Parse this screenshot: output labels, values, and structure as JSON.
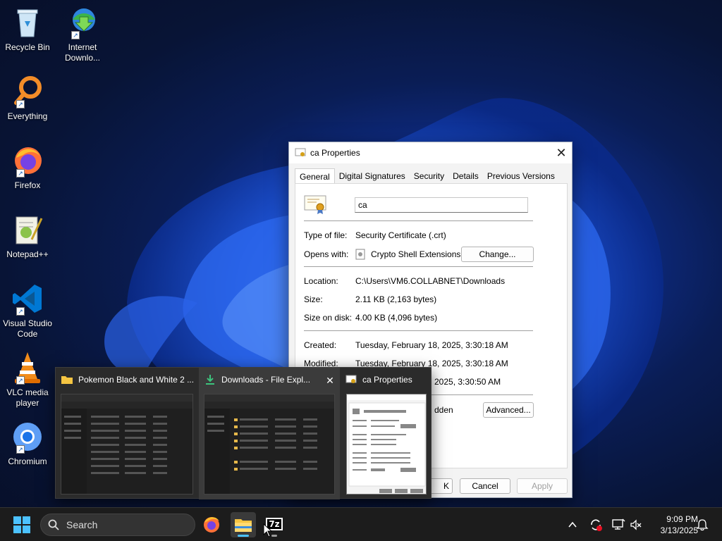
{
  "desktop": {
    "icons": [
      {
        "label": "Recycle Bin",
        "icon": "recycle-bin-icon"
      },
      {
        "label": "Internet Downlo...",
        "icon": "internet-download-manager-icon"
      },
      {
        "label": "Everything",
        "icon": "everything-search-icon"
      },
      {
        "label": "Firefox",
        "icon": "firefox-icon"
      },
      {
        "label": "Notepad++",
        "icon": "notepad-plus-plus-icon"
      },
      {
        "label": "Visual Studio Code",
        "icon": "vscode-icon"
      },
      {
        "label": "VLC media player",
        "icon": "vlc-icon"
      },
      {
        "label": "Chromium",
        "icon": "chromium-icon"
      }
    ]
  },
  "dialog": {
    "title": "ca Properties",
    "close_glyph": "✕",
    "tabs": [
      "General",
      "Digital Signatures",
      "Security",
      "Details",
      "Previous Versions"
    ],
    "active_tab": "General",
    "file_name": "ca",
    "type_label": "Type of file:",
    "type_value": "Security Certificate (.crt)",
    "opens_label": "Opens with:",
    "opens_value": "Crypto Shell Extensions",
    "change_button": "Change...",
    "location_label": "Location:",
    "location_value": "C:\\Users\\VM6.COLLABNET\\Downloads",
    "size_label": "Size:",
    "size_value": "2.11 KB (2,163 bytes)",
    "size_on_disk_label": "Size on disk:",
    "size_on_disk_value": "4.00 KB (4,096 bytes)",
    "created_label": "Created:",
    "created_value": "Tuesday, February 18, 2025, 3:30:18 AM",
    "modified_label": "Modified:",
    "modified_value": "Tuesday, February 18, 2025, 3:30:18 AM",
    "accessed_value_partial": "2025, 3:30:50 AM",
    "hidden_partial": "dden",
    "advanced_button": "Advanced...",
    "ok_partial": "K",
    "cancel_button": "Cancel",
    "apply_button": "Apply"
  },
  "flyout": {
    "thumbnails": [
      {
        "title": "Pokemon Black and White 2 ...",
        "icon": "folder-icon"
      },
      {
        "title": "Downloads - File Expl...",
        "icon": "download-icon",
        "close": "✕"
      },
      {
        "title": "ca Properties",
        "icon": "certificate-icon"
      }
    ]
  },
  "taskbar": {
    "search_placeholder": "Search",
    "apps": [
      "firefox-icon",
      "file-explorer-icon",
      "7zip-icon"
    ],
    "seven_zip_label": "7z",
    "time": "9:09 PM",
    "date": "3/13/2025"
  },
  "colors": {
    "accent": "#4cc2ff",
    "desktop_bg": "#0a1d55",
    "taskbar_bg": "#1c1c1c"
  }
}
